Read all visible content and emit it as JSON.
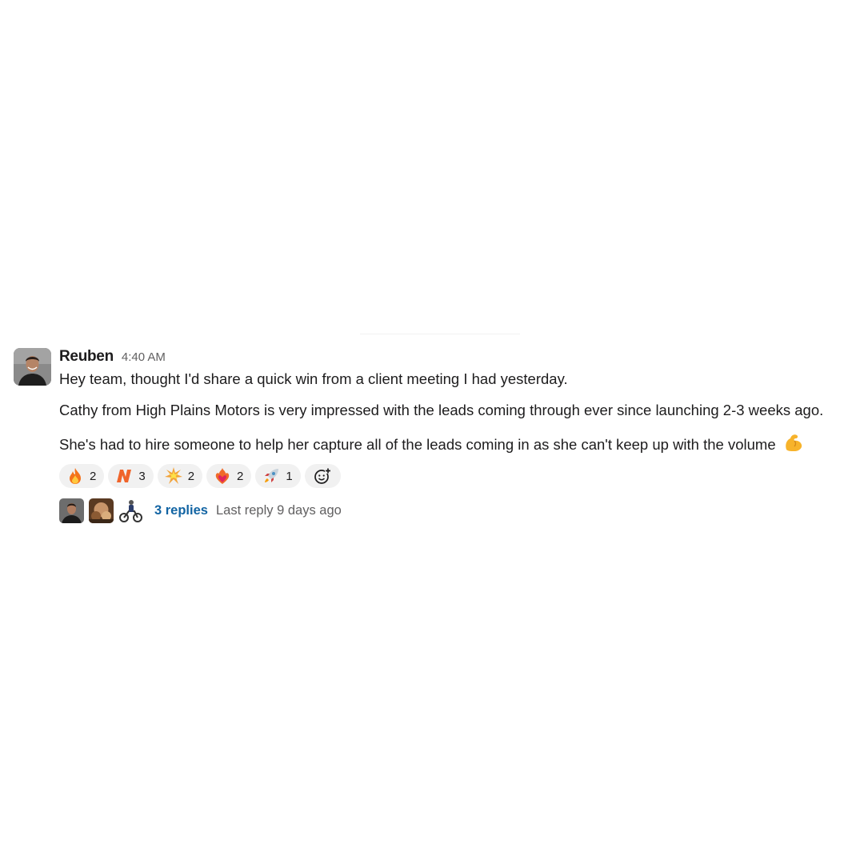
{
  "message": {
    "author": "Reuben",
    "time": "4:40 AM",
    "lines": [
      "Hey team, thought I'd share a quick win from a client meeting I had yesterday.",
      "Cathy from High Plains Motors is very impressed with the leads coming through ever since launching 2-3 weeks ago.",
      "She's had to hire someone to help her capture all of the leads coming in as she can't keep up with the volume"
    ],
    "trailing_emoji": "flexed-biceps-icon"
  },
  "reactions": [
    {
      "icon": "fire-icon",
      "count": "2"
    },
    {
      "icon": "n-logo-icon",
      "count": "3"
    },
    {
      "icon": "collision-icon",
      "count": "2"
    },
    {
      "icon": "heart-on-fire-icon",
      "count": "2"
    },
    {
      "icon": "rocket-icon",
      "count": "1"
    }
  ],
  "thread": {
    "replies_label": "3 replies",
    "last_reply": "Last reply 9 days ago"
  },
  "colors": {
    "link": "#1264a3",
    "muted": "#616061",
    "text": "#1d1c1d",
    "reaction_bg": "#f1f1f1",
    "n_logo": "#f0642a"
  }
}
